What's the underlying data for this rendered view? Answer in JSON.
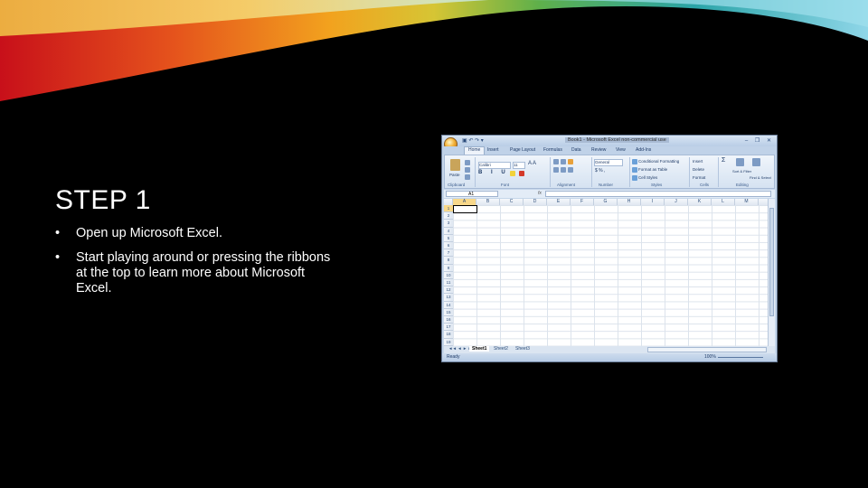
{
  "slide": {
    "title": "STEP 1",
    "bullets": [
      {
        "marker": "•",
        "text": "Open up Microsoft Excel."
      },
      {
        "marker": "•",
        "text": "Start playing around or pressing the ribbons at the top to learn more about Microsoft Excel."
      }
    ]
  },
  "excel": {
    "title": "Book1 - Microsoft Excel non-commercial use",
    "qat": "▣ ↶ ↷ ▾",
    "window_controls": "– ❐ ✕",
    "tabs": [
      "Home",
      "Insert",
      "Page Layout",
      "Formulas",
      "Data",
      "Review",
      "View",
      "Add-Ins"
    ],
    "active_tab": "Home",
    "ribbon": {
      "paste": "Paste",
      "font_name": "Calibri",
      "font_size": "11",
      "number_format": "General",
      "conditional_formatting": "Conditional Formatting",
      "format_as_table": "Format as Table",
      "cell_styles": "Cell Styles",
      "insert": "Insert",
      "delete": "Delete",
      "format": "Format",
      "sort_filter": "Sort & Filter",
      "find_select": "Find & Select",
      "groups": [
        "Clipboard",
        "Font",
        "Alignment",
        "Number",
        "Styles",
        "Cells",
        "Editing"
      ]
    },
    "name_box": "A1",
    "fx": "fx",
    "columns": [
      "A",
      "B",
      "C",
      "D",
      "E",
      "F",
      "G",
      "H",
      "I",
      "J",
      "K",
      "L",
      "M"
    ],
    "rows": [
      "1",
      "2",
      "3",
      "4",
      "5",
      "6",
      "7",
      "8",
      "9",
      "10",
      "11",
      "12",
      "13",
      "14",
      "15",
      "16",
      "17",
      "18",
      "19"
    ],
    "sheets": [
      "Sheet1",
      "Sheet2",
      "Sheet3"
    ],
    "status": "Ready",
    "zoom": "100%"
  }
}
